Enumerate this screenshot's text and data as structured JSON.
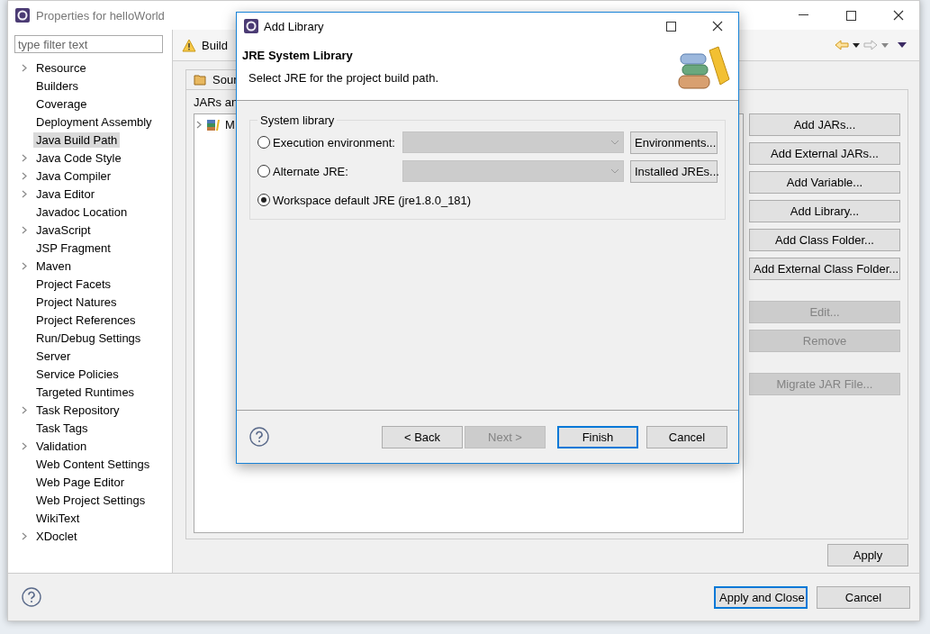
{
  "window": {
    "title": "Properties for helloWorld"
  },
  "filter": {
    "placeholder": "type filter text"
  },
  "sidebar": {
    "items": [
      {
        "label": "Resource",
        "expandable": true,
        "selected": false
      },
      {
        "label": "Builders",
        "expandable": false,
        "selected": false
      },
      {
        "label": "Coverage",
        "expandable": false,
        "selected": false
      },
      {
        "label": "Deployment Assembly",
        "expandable": false,
        "selected": false
      },
      {
        "label": "Java Build Path",
        "expandable": false,
        "selected": true
      },
      {
        "label": "Java Code Style",
        "expandable": true,
        "selected": false
      },
      {
        "label": "Java Compiler",
        "expandable": true,
        "selected": false
      },
      {
        "label": "Java Editor",
        "expandable": true,
        "selected": false
      },
      {
        "label": "Javadoc Location",
        "expandable": false,
        "selected": false
      },
      {
        "label": "JavaScript",
        "expandable": true,
        "selected": false
      },
      {
        "label": "JSP Fragment",
        "expandable": false,
        "selected": false
      },
      {
        "label": "Maven",
        "expandable": true,
        "selected": false
      },
      {
        "label": "Project Facets",
        "expandable": false,
        "selected": false
      },
      {
        "label": "Project Natures",
        "expandable": false,
        "selected": false
      },
      {
        "label": "Project References",
        "expandable": false,
        "selected": false
      },
      {
        "label": "Run/Debug Settings",
        "expandable": false,
        "selected": false
      },
      {
        "label": "Server",
        "expandable": false,
        "selected": false
      },
      {
        "label": "Service Policies",
        "expandable": false,
        "selected": false
      },
      {
        "label": "Targeted Runtimes",
        "expandable": false,
        "selected": false
      },
      {
        "label": "Task Repository",
        "expandable": true,
        "selected": false
      },
      {
        "label": "Task Tags",
        "expandable": false,
        "selected": false
      },
      {
        "label": "Validation",
        "expandable": true,
        "selected": false
      },
      {
        "label": "Web Content Settings",
        "expandable": false,
        "selected": false
      },
      {
        "label": "Web Page Editor",
        "expandable": false,
        "selected": false
      },
      {
        "label": "Web Project Settings",
        "expandable": false,
        "selected": false
      },
      {
        "label": "WikiText",
        "expandable": false,
        "selected": false
      },
      {
        "label": "XDoclet",
        "expandable": true,
        "selected": false
      }
    ]
  },
  "page": {
    "title": "Build",
    "tab": "Sour",
    "description": "JARs an",
    "tree_items": [
      {
        "label": "M"
      }
    ]
  },
  "side_buttons": [
    {
      "label": "Add JARs...",
      "disabled": false
    },
    {
      "label": "Add External JARs...",
      "disabled": false
    },
    {
      "label": "Add Variable...",
      "disabled": false
    },
    {
      "label": "Add Library...",
      "disabled": false
    },
    {
      "label": "Add Class Folder...",
      "disabled": false
    },
    {
      "label": "Add External Class Folder...",
      "disabled": false
    },
    {
      "label": "Edit...",
      "disabled": true
    },
    {
      "label": "Remove",
      "disabled": true
    },
    {
      "label": "Migrate JAR File...",
      "disabled": true
    }
  ],
  "apply": "Apply",
  "footer_buttons": [
    {
      "label": "Apply and Close",
      "default": true
    },
    {
      "label": "Cancel",
      "default": false
    }
  ],
  "dialog": {
    "title": "Add Library",
    "heading": "JRE System Library",
    "subtitle": "Select JRE for the project build path.",
    "group": "System library",
    "options": [
      {
        "label": "Execution environment:",
        "selected": false,
        "kind": "combo",
        "button": "Environments..."
      },
      {
        "label": "Alternate JRE:",
        "selected": false,
        "kind": "combo",
        "button": "Installed JREs..."
      },
      {
        "label": "Workspace default JRE (jre1.8.0_181)",
        "selected": true,
        "kind": "plain"
      }
    ],
    "buttons": [
      {
        "label": "< Back",
        "disabled": false,
        "default": false
      },
      {
        "label": "Next >",
        "disabled": true,
        "default": false
      },
      {
        "label": "Finish",
        "disabled": false,
        "default": true
      },
      {
        "label": "Cancel",
        "disabled": false,
        "default": false
      }
    ]
  }
}
